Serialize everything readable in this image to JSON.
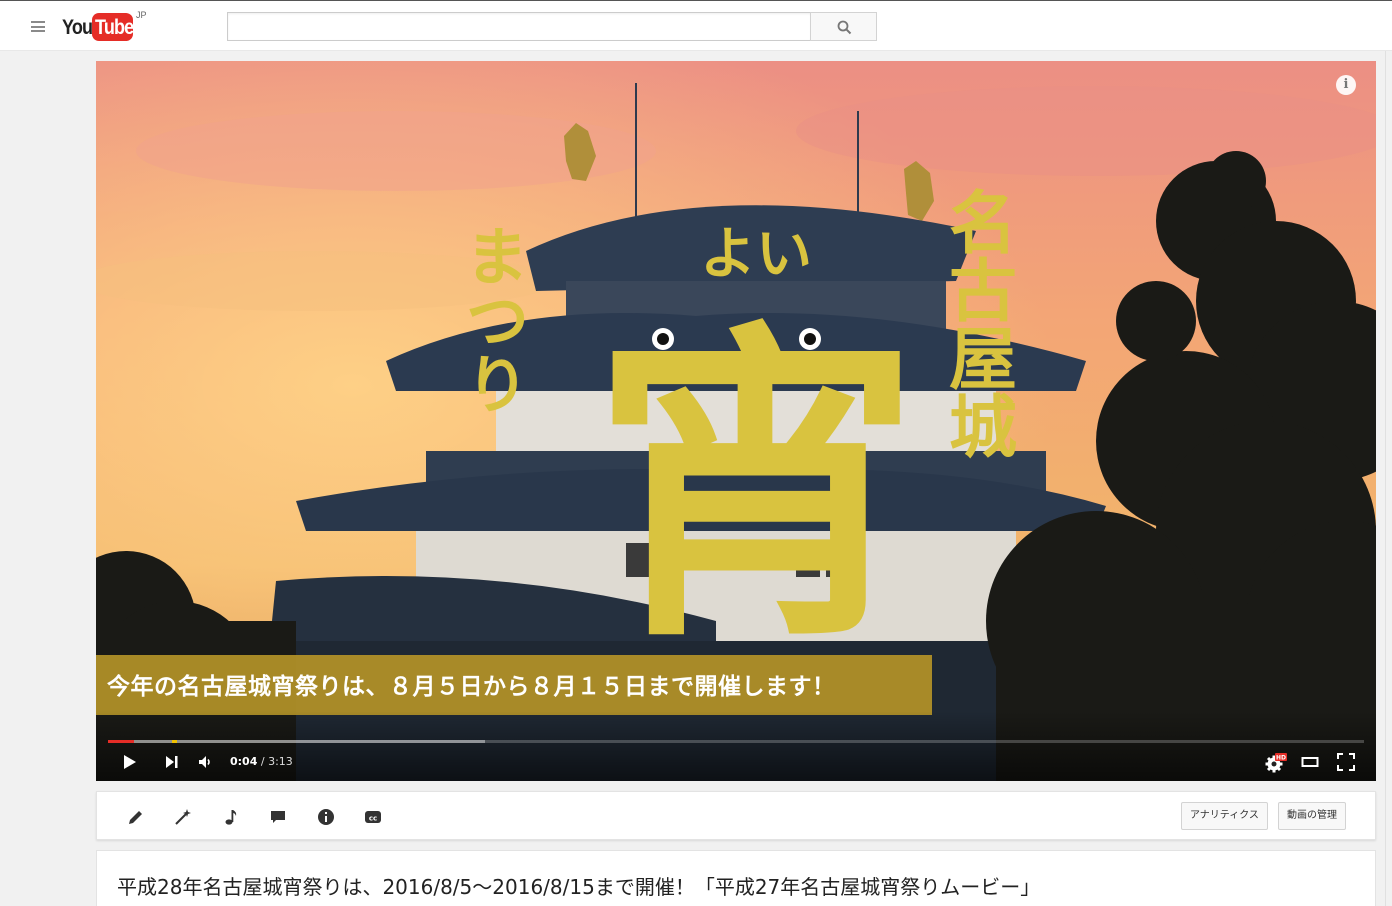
{
  "masthead": {
    "logo_you": "You",
    "logo_tube": "Tube",
    "country_code": "JP",
    "search_value": "",
    "search_placeholder": ""
  },
  "player": {
    "title_graphic": {
      "left_column": "まつり",
      "top_kana": "よい",
      "center_kanji": "宵",
      "right_column": "名古屋城"
    },
    "caption_banner": "今年の名古屋城宵祭りは、８月５日から８月１５日まで開催します！",
    "current_time": "0:04",
    "separator": " / ",
    "duration": "3:13",
    "progress_played_fraction": 0.021,
    "progress_loaded_fraction": 0.3,
    "quality_badge": "HD",
    "brand_red": "#e52d27",
    "banner_gold": "#b39228"
  },
  "creator_bar": {
    "icons": [
      "pencil-icon",
      "magic-wand-icon",
      "music-note-icon",
      "comment-icon",
      "info-icon",
      "cc-icon"
    ],
    "analytics_label": "アナリティクス",
    "manage_label": "動画の管理"
  },
  "video": {
    "title": "平成28年名古屋城宵祭りは、2016/8/5〜2016/8/15まで開催！「平成27年名古屋城宵祭りムービー」"
  }
}
